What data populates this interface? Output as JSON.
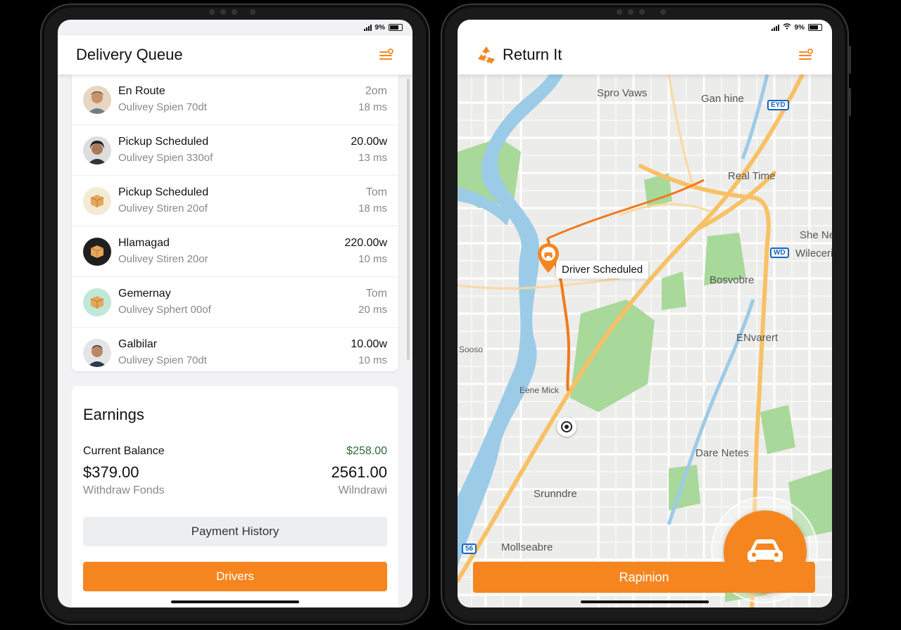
{
  "left": {
    "status": {
      "battery": "9%"
    },
    "header": {
      "title": "Delivery Queue"
    },
    "queue": [
      {
        "title": "En Route",
        "subtitle": "Oulivey Spien 70dt",
        "right_top": "2om",
        "right_bottom": "18 ms",
        "avatar": "person-1"
      },
      {
        "title": "Pickup Scheduled",
        "subtitle": "Oulivey Spien 330of",
        "right_top": "20.00w",
        "right_bottom": "13 ms",
        "avatar": "person-2"
      },
      {
        "title": "Pickup Scheduled",
        "subtitle": "Oulivey Stiren 20of",
        "right_top": "Tom",
        "right_bottom": "18 ms",
        "avatar": "package-icon"
      },
      {
        "title": "Hlamagad",
        "subtitle": "Oulivey Stiren 20or",
        "right_top": "220.00w",
        "right_bottom": "10 ms",
        "avatar": "package-icon"
      },
      {
        "title": "Gemernay",
        "subtitle": "Oulivey Sphert 00of",
        "right_top": "Tom",
        "right_bottom": "20 ms",
        "avatar": "package-icon"
      },
      {
        "title": "Galbilar",
        "subtitle": "Oulivey Spien 70dt",
        "right_top": "10.00w",
        "right_bottom": "10 ms",
        "avatar": "person-3"
      }
    ],
    "earnings": {
      "title": "Earnings",
      "balance_label": "Current Balance",
      "balance_right": "$258.00",
      "amount_left": "$379.00",
      "amount_right": "2561.00",
      "withdraw_left": "Withdraw Fonds",
      "withdraw_right": "Wilndrawi",
      "payment_history": "Payment History",
      "drivers": "Drivers"
    }
  },
  "right": {
    "status": {
      "battery": "9%"
    },
    "header": {
      "title": "Return It"
    },
    "map": {
      "labels": [
        "Spro Vaws",
        "Gan hine",
        "Real Time",
        "She Ne",
        "Wileceri",
        "Bosvobre",
        "ENvarert",
        "Eene Mick",
        "Dare Netes",
        "Srunndre",
        "Mollseabre",
        "Sooso"
      ],
      "pin_label": "Driver Scheduled",
      "shields": [
        "EYD",
        "WD",
        "56"
      ]
    },
    "action_button": "Rapinion"
  },
  "colors": {
    "accent": "#f5861f",
    "balance_positive": "#2d6b34",
    "water": "#9ccbe8",
    "park": "#a8d89a",
    "road_major": "#f8c165",
    "route": "#f07a1c"
  }
}
